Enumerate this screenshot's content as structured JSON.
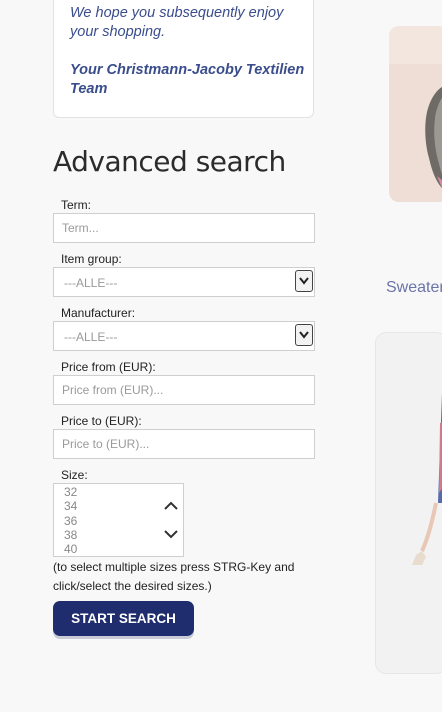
{
  "notice": {
    "message": "We hope you subsequently enjoy your shopping.",
    "signature": "Your Christmann-Jacoby Textilien Team"
  },
  "search": {
    "title": "Advanced search",
    "term": {
      "label": "Term:",
      "placeholder": "Term..."
    },
    "item_group": {
      "label": "Item group:",
      "value": "---ALLE---"
    },
    "manufacturer": {
      "label": "Manufacturer:",
      "value": "---ALLE---"
    },
    "price_from": {
      "label": "Price from (EUR):",
      "placeholder": "Price from (EUR)..."
    },
    "price_to": {
      "label": "Price to (EUR):",
      "placeholder": "Price to (EUR)..."
    },
    "size": {
      "label": "Size:",
      "options": [
        "32",
        "34",
        "36",
        "38",
        "40"
      ]
    },
    "hint": "(to select multiple sizes press STRG-Key and click/select the desired sizes.)",
    "button": "START SEARCH"
  },
  "products": {
    "second_title": "Sweater"
  },
  "colors": {
    "accent": "#1f2d6e",
    "notice_text": "#3a4d8c",
    "product_title": "#6a74a8"
  }
}
